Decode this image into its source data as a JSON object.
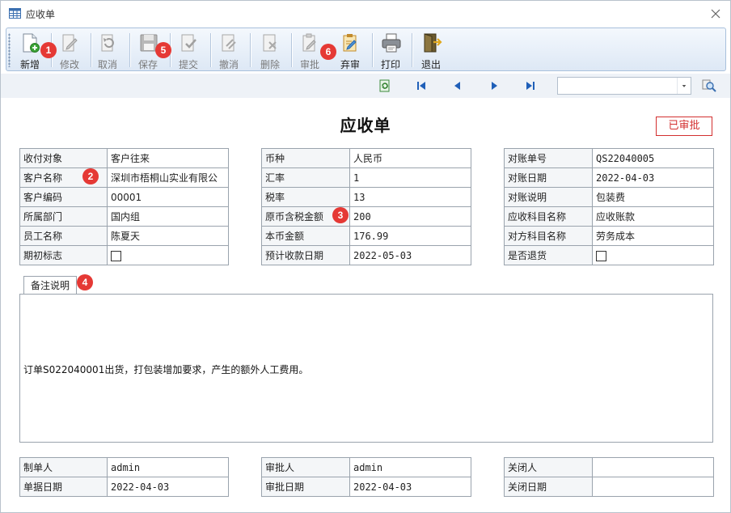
{
  "window": {
    "title": "应收单"
  },
  "toolbar": {
    "buttons": [
      {
        "label": "新增",
        "enabled": true
      },
      {
        "label": "修改",
        "enabled": false
      },
      {
        "label": "取消",
        "enabled": false
      },
      {
        "label": "保存",
        "enabled": false
      },
      {
        "label": "提交",
        "enabled": false
      },
      {
        "label": "撤消",
        "enabled": false
      },
      {
        "label": "删除",
        "enabled": false
      },
      {
        "label": "审批",
        "enabled": false
      },
      {
        "label": "弃审",
        "enabled": true
      },
      {
        "label": "打印",
        "enabled": true
      },
      {
        "label": "退出",
        "enabled": true
      }
    ]
  },
  "markers": [
    "1",
    "2",
    "3",
    "4",
    "5",
    "6"
  ],
  "nav": {
    "search_value": ""
  },
  "page_title": "应收单",
  "status": "已审批",
  "left_table": [
    {
      "label": "收付对象",
      "value": "客户往来"
    },
    {
      "label": "客户名称",
      "value": "深圳市梧桐山实业有限公"
    },
    {
      "label": "客户编码",
      "value": "00001"
    },
    {
      "label": "所属部门",
      "value": "国内组"
    },
    {
      "label": "员工名称",
      "value": "陈夏天"
    },
    {
      "label": "期初标志",
      "value": ""
    }
  ],
  "mid_table": [
    {
      "label": "币种",
      "value": "人民币"
    },
    {
      "label": "汇率",
      "value": "1"
    },
    {
      "label": "税率",
      "value": "13"
    },
    {
      "label": "原币含税金额",
      "value": "200"
    },
    {
      "label": "本币金额",
      "value": "176.99"
    },
    {
      "label": "预计收款日期",
      "value": "2022-05-03"
    }
  ],
  "right_table": [
    {
      "label": "对账单号",
      "value": "QS22040005"
    },
    {
      "label": "对账日期",
      "value": "2022-04-03"
    },
    {
      "label": "对账说明",
      "value": "包装费"
    },
    {
      "label": "应收科目名称",
      "value": "应收账款"
    },
    {
      "label": "对方科目名称",
      "value": "劳务成本"
    },
    {
      "label": "是否退货",
      "value": ""
    }
  ],
  "tab": {
    "label": "备注说明"
  },
  "notes": {
    "text": "订单S022040001出货，打包装增加要求，产生的额外人工费用。"
  },
  "footer_left": [
    {
      "label": "制单人",
      "value": "admin"
    },
    {
      "label": "单据日期",
      "value": "2022-04-03"
    }
  ],
  "footer_mid": [
    {
      "label": "审批人",
      "value": "admin"
    },
    {
      "label": "审批日期",
      "value": "2022-04-03"
    }
  ],
  "footer_right": [
    {
      "label": "关闭人",
      "value": ""
    },
    {
      "label": "关闭日期",
      "value": ""
    }
  ]
}
